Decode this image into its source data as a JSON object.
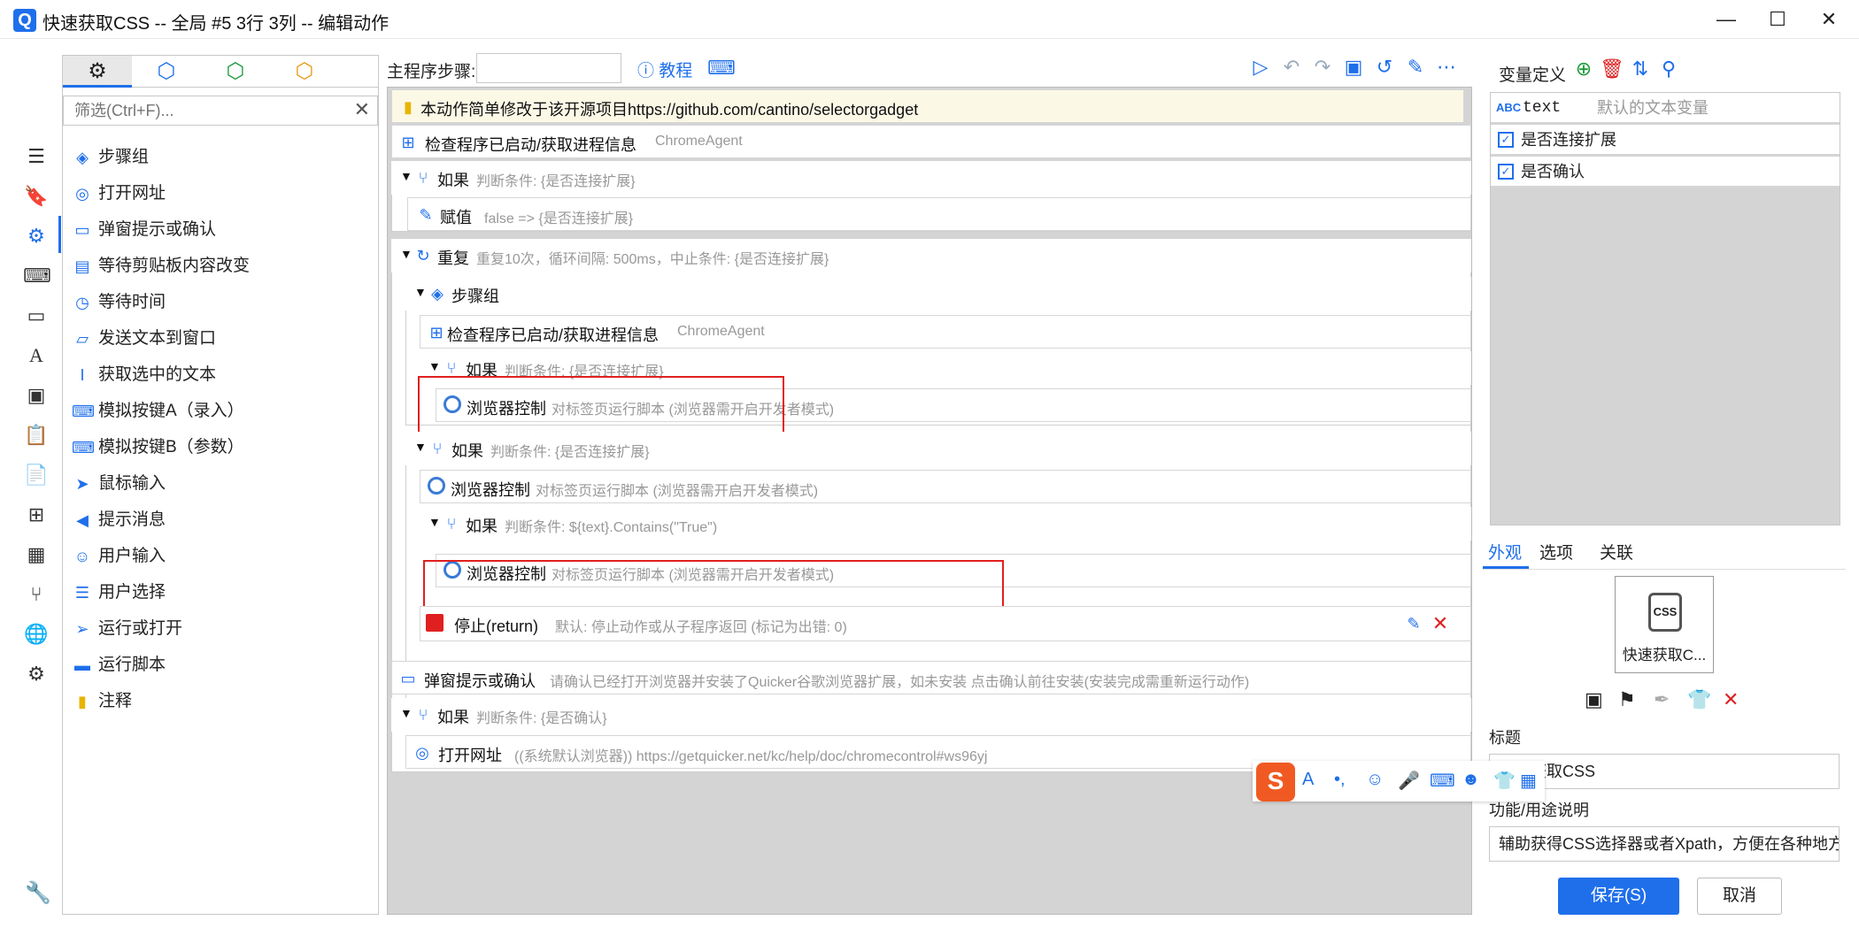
{
  "window": {
    "title": "快速获取CSS -- 全局 #5 3行 3列 -- 编辑动作",
    "minimize": "—",
    "maximize": "☐",
    "close": "✕"
  },
  "toolbox": {
    "filter_placeholder": "筛选(Ctrl+F)...",
    "items": [
      {
        "label": "步骤组",
        "icon": "layers-icon"
      },
      {
        "label": "打开网址",
        "icon": "globe-icon"
      },
      {
        "label": "弹窗提示或确认",
        "icon": "dialog-icon"
      },
      {
        "label": "等待剪贴板内容改变",
        "icon": "clipboard-icon"
      },
      {
        "label": "等待时间",
        "icon": "timer-icon"
      },
      {
        "label": "发送文本到窗口",
        "icon": "message-icon"
      },
      {
        "label": "获取选中的文本",
        "icon": "text-cursor-icon"
      },
      {
        "label": "模拟按键A（录入）",
        "icon": "keyboard-icon"
      },
      {
        "label": "模拟按键B（参数）",
        "icon": "keyboard-icon"
      },
      {
        "label": "鼠标输入",
        "icon": "mouse-pointer-icon"
      },
      {
        "label": "提示消息",
        "icon": "megaphone-icon"
      },
      {
        "label": "用户输入",
        "icon": "user-edit-icon"
      },
      {
        "label": "用户选择",
        "icon": "list-icon"
      },
      {
        "label": "运行或打开",
        "icon": "send-icon"
      },
      {
        "label": "运行脚本",
        "icon": "script-icon"
      },
      {
        "label": "注释",
        "icon": "note-icon"
      }
    ]
  },
  "main": {
    "steps_label": "主程序步骤:",
    "tutorial": "教程"
  },
  "steps": {
    "note": "本动作简单修改于该开源项目https://github.com/cantino/selectorgadget",
    "r1_name": "检查程序已启动/获取进程信息",
    "r1_desc": "ChromeAgent",
    "if1_name": "如果",
    "if1_desc": "判断条件: {是否连接扩展}",
    "assign_name": "赋值",
    "assign_desc": "false => {是否连接扩展}",
    "repeat_name": "重复",
    "repeat_desc": "重复10次，循环间隔: 500ms，中止条件: {是否连接扩展}",
    "group_name": "步骤组",
    "r2_name": "检查程序已启动/获取进程信息",
    "r2_desc": "ChromeAgent",
    "if2_name": "如果",
    "if2_desc": "判断条件: {是否连接扩展}",
    "browser1_name": "浏览器控制",
    "browser1_desc": "对标签页运行脚本 (浏览器需开启开发者模式)",
    "if3_name": "如果",
    "if3_desc": "判断条件: {是否连接扩展}",
    "browser2_name": "浏览器控制",
    "browser2_desc": "对标签页运行脚本 (浏览器需开启开发者模式)",
    "if4_name": "如果",
    "if4_desc": "判断条件: ${text}.Contains(\"True\")",
    "browser3_name": "浏览器控制",
    "browser3_desc": "对标签页运行脚本 (浏览器需开启开发者模式)",
    "stop_name": "停止(return)",
    "stop_desc": "默认: 停止动作或从子程序返回 (标记为出错: 0)",
    "dialog_name": "弹窗提示或确认",
    "dialog_desc": "请确认已经打开浏览器并安装了Quicker谷歌浏览器扩展，如未安装 点击确认前往安装(安装完成需重新运行动作)",
    "if5_name": "如果",
    "if5_desc": "判断条件: {是否确认}",
    "openurl_name": "打开网址",
    "openurl_desc": "((系统默认浏览器)) https://getquicker.net/kc/help/doc/chromecontrol#ws96yj"
  },
  "vars": {
    "title": "变量定义",
    "items": [
      {
        "type": "ABC",
        "name": "text",
        "desc": "默认的文本变量"
      },
      {
        "name": "是否连接扩展"
      },
      {
        "name": "是否确认"
      }
    ]
  },
  "props": {
    "tabs": [
      "外观",
      "选项",
      "关联"
    ],
    "card_label": "快速获取C...",
    "card_icon_text": "CSS",
    "title_label": "标题",
    "title_value": "快速获取CSS",
    "desc_label": "功能/用途说明",
    "desc_value": "辅助获得CSS选择器或者Xpath，方便在各种地方",
    "save": "保存(S)",
    "cancel": "取消"
  },
  "colors": {
    "accent": "#1f6feb",
    "highlight": "#e02020",
    "ime": "#f05a22"
  }
}
